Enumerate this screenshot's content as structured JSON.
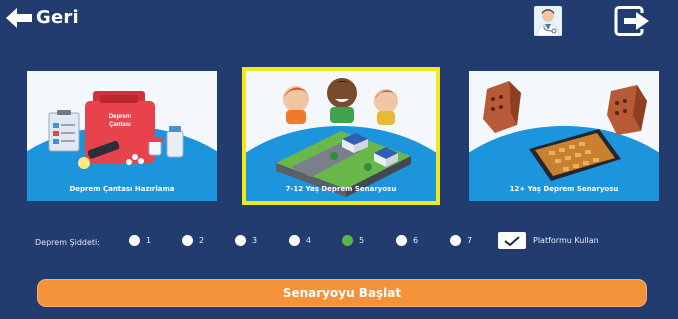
{
  "header": {
    "back_label": "Geri"
  },
  "cards": [
    {
      "caption": "Deprem Çantası Hazırlama",
      "case_text_1": "Deprem",
      "case_text_2": "Çantası"
    },
    {
      "caption": "7-12 Yaş Deprem Senaryosu"
    },
    {
      "caption": "12+ Yaş Deprem Senaryosu"
    }
  ],
  "severity": {
    "label": "Deprem Şiddeti:",
    "options": [
      "1",
      "2",
      "3",
      "4",
      "5",
      "6",
      "7"
    ],
    "selected": "5"
  },
  "platform": {
    "label": "Platformu Kullan",
    "checked": true
  },
  "start_button": "Senaryoyu Başlat",
  "colors": {
    "background": "#223c6f",
    "accent_orange": "#f3923a",
    "selected_green": "#5bb54a",
    "highlight_yellow": "#f1e81d",
    "scene_blue": "#1d95dd"
  }
}
